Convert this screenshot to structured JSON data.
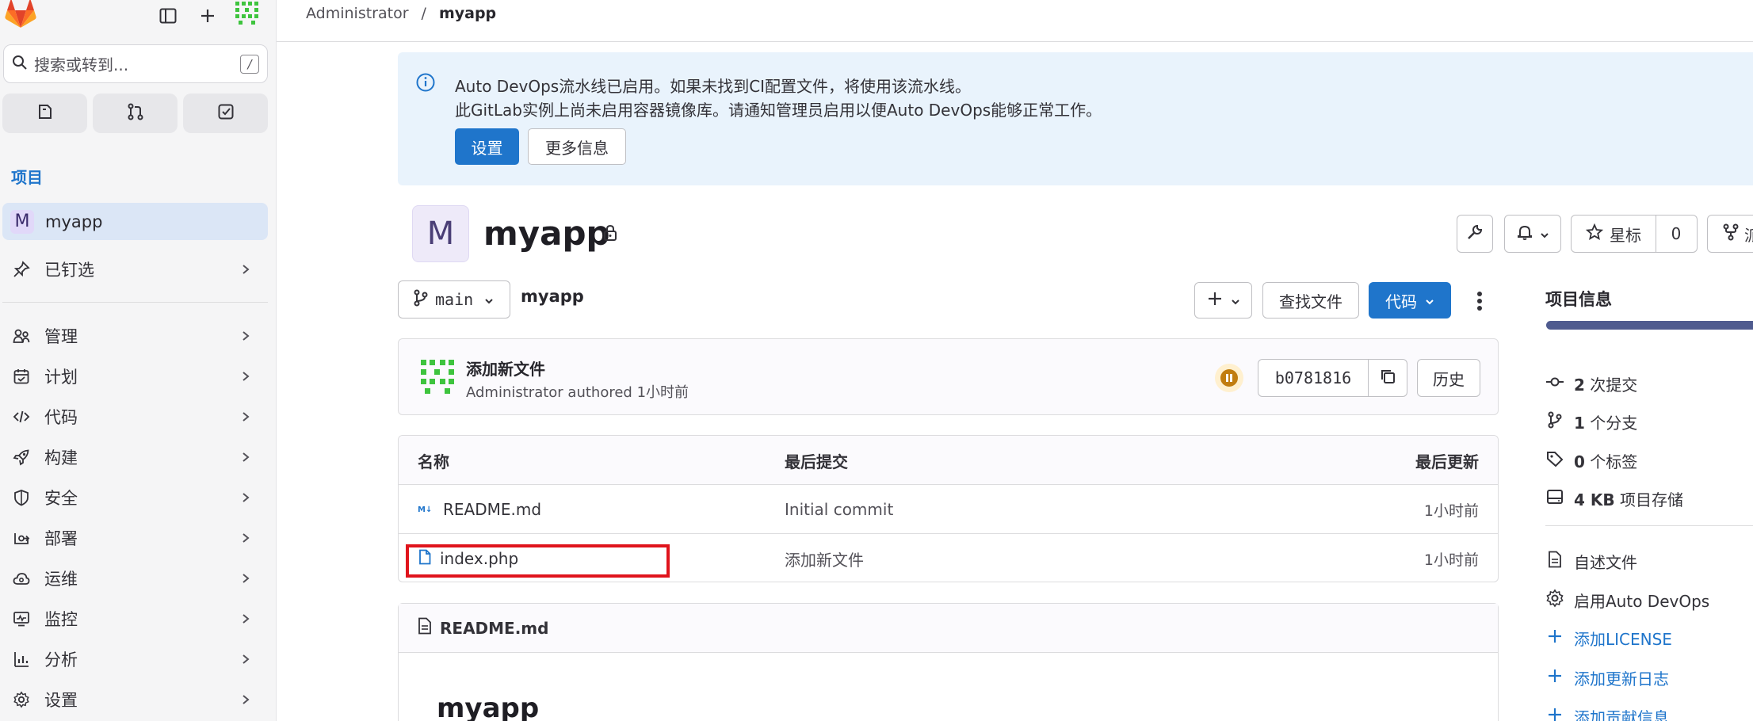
{
  "search": {
    "placeholder": "搜索或转到...",
    "shortcut": "/"
  },
  "sidebar": {
    "section_title": "项目",
    "project": {
      "initial": "M",
      "label": "myapp"
    },
    "pinned": "已钉选",
    "items": [
      {
        "label": "管理",
        "icon": "users-icon"
      },
      {
        "label": "计划",
        "icon": "calendar-icon"
      },
      {
        "label": "代码",
        "icon": "code-icon"
      },
      {
        "label": "构建",
        "icon": "rocket-icon"
      },
      {
        "label": "安全",
        "icon": "shield-icon"
      },
      {
        "label": "部署",
        "icon": "deploy-icon"
      },
      {
        "label": "运维",
        "icon": "cloud-gear-icon"
      },
      {
        "label": "监控",
        "icon": "monitor-icon"
      },
      {
        "label": "分析",
        "icon": "chart-icon"
      },
      {
        "label": "设置",
        "icon": "gear-icon"
      }
    ]
  },
  "breadcrumb": {
    "parent": "Administrator",
    "sep": "/",
    "current": "myapp"
  },
  "alert": {
    "line1": "Auto DevOps流水线已启用。如果未找到CI配置文件，将使用该流水线。",
    "line2": "此GitLab实例上尚未启用容器镜像库。请通知管理员启用以便Auto DevOps能够正常工作。",
    "primary_button": "设置",
    "secondary_button": "更多信息"
  },
  "project": {
    "initial": "M",
    "name": "myapp",
    "star_label": "星标",
    "star_count": "0",
    "fork_label": "派"
  },
  "repo": {
    "branch": "main",
    "path": "myapp",
    "find_file": "查找文件",
    "code_button": "代码"
  },
  "last_commit": {
    "title": "添加新文件",
    "meta": "Administrator authored 1小时前",
    "sha": "b0781816",
    "history": "历史"
  },
  "tree": {
    "headers": {
      "name": "名称",
      "commit": "最后提交",
      "updated": "最后更新"
    },
    "rows": [
      {
        "name": "README.md",
        "commit": "Initial commit",
        "updated": "1小时前",
        "icon": "markdown-icon"
      },
      {
        "name": "index.php",
        "commit": "添加新文件",
        "updated": "1小时前",
        "icon": "file-icon"
      }
    ]
  },
  "readme": {
    "filename": "README.md",
    "heading": "myapp"
  },
  "project_info": {
    "title": "项目信息",
    "stats": [
      {
        "count": "2",
        "label": "次提交"
      },
      {
        "count": "1",
        "label": "个分支"
      },
      {
        "count": "0",
        "label": "个标签"
      },
      {
        "count": "4 KB",
        "label": "项目存储"
      }
    ],
    "links": [
      {
        "label": "自述文件"
      },
      {
        "label": "启用Auto DevOps"
      },
      {
        "label": "添加LICENSE"
      },
      {
        "label": "添加更新日志"
      },
      {
        "label": "添加贡献信息"
      }
    ]
  },
  "colors": {
    "primary": "#1f75cb",
    "highlight": "#e0141c",
    "sidebar_bg": "#f5f5f6",
    "alert_bg": "#e9f3fc"
  }
}
